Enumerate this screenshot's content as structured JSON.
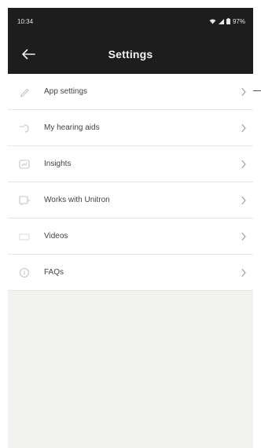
{
  "status_bar": {
    "time": "10:34",
    "battery": "97%",
    "icons": [
      "wifi-icon",
      "signal-icon",
      "battery-icon"
    ]
  },
  "app_bar": {
    "title": "Settings",
    "back_icon": "arrow-left-icon"
  },
  "menu": {
    "items": [
      {
        "label": "App settings",
        "icon": "pencil-icon"
      },
      {
        "label": "My hearing aids",
        "icon": "hearing-aid-icon"
      },
      {
        "label": "Insights",
        "icon": "insights-icon"
      },
      {
        "label": "Works with Unitron",
        "icon": "works-with-icon"
      },
      {
        "label": "Videos",
        "icon": "video-icon"
      },
      {
        "label": "FAQs",
        "icon": "faq-icon"
      }
    ],
    "chevron_icon": "chevron-right-icon"
  },
  "colors": {
    "app_bar_bg": "#1d1d1d",
    "list_bg": "#ffffff",
    "page_bg": "#f1f1ef",
    "text": "#444444"
  }
}
